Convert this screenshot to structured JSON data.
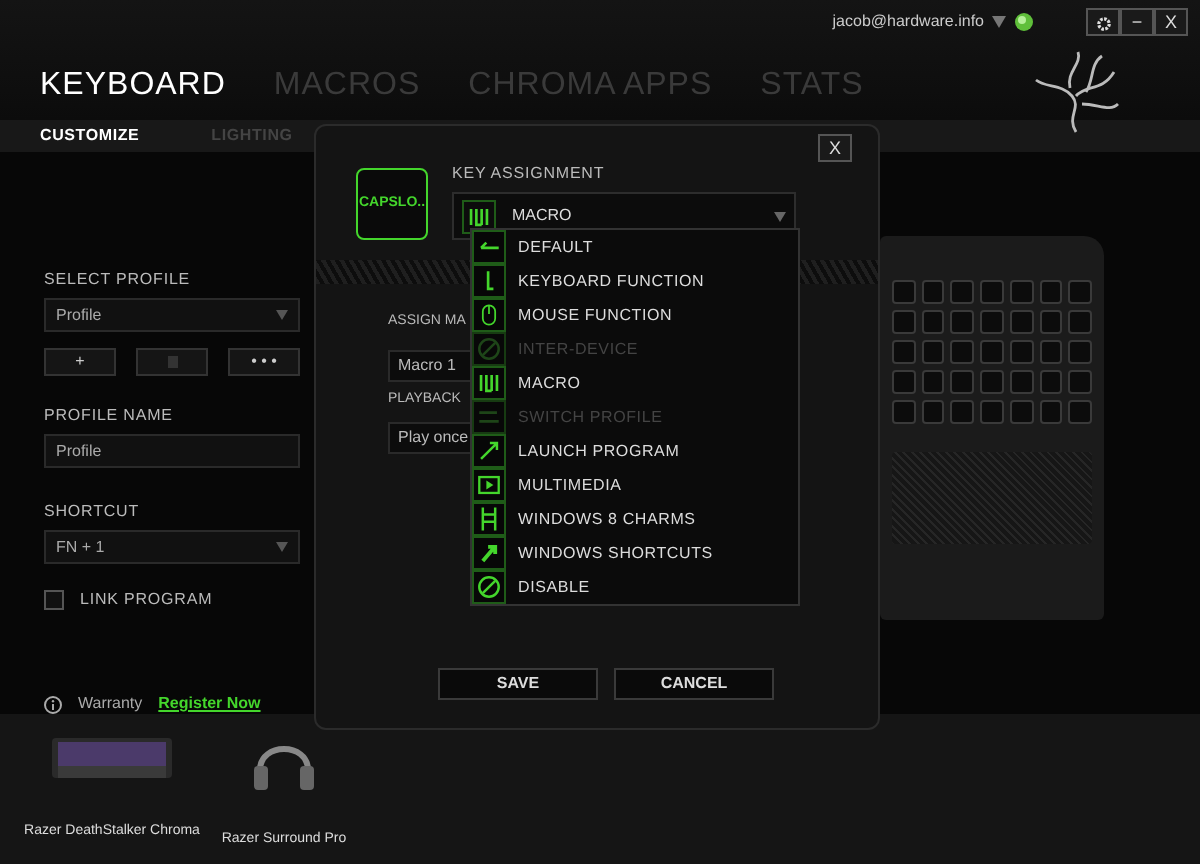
{
  "account": {
    "email": "jacob@hardware.info"
  },
  "window_buttons": [
    "−",
    "X"
  ],
  "tabs": [
    {
      "label": "KEYBOARD",
      "selected": true
    },
    {
      "label": "MACROS",
      "selected": false
    },
    {
      "label": "CHROMA APPS",
      "selected": false
    },
    {
      "label": "STATS",
      "selected": false
    }
  ],
  "subtabs": [
    {
      "label": "CUSTOMIZE",
      "selected": true
    },
    {
      "label": "LIGHTING",
      "selected": false
    }
  ],
  "profile_panel": {
    "select_label": "SELECT PROFILE",
    "profile": "Profile",
    "add_button": "+",
    "more_button": "• • •",
    "name_label": "PROFILE NAME",
    "name_value": "Profile",
    "shortcut_label": "SHORTCUT",
    "shortcut": "FN + 1",
    "link_program": {
      "label": "LINK PROGRAM",
      "checked": false
    }
  },
  "warranty": {
    "label": "Warranty",
    "link": "Register Now"
  },
  "devices": [
    {
      "name": "Razer DeathStalker Chroma"
    },
    {
      "name": "Razer Surround Pro"
    }
  ],
  "dialog": {
    "close": "X",
    "key": "CAPSLO..",
    "title": "KEY ASSIGNMENT",
    "assignment": "MACRO",
    "expanded": true,
    "options": [
      {
        "label": "DEFAULT",
        "disabled": false
      },
      {
        "label": "KEYBOARD FUNCTION",
        "disabled": false
      },
      {
        "label": "MOUSE FUNCTION",
        "disabled": false
      },
      {
        "label": "INTER-DEVICE",
        "disabled": true
      },
      {
        "label": "MACRO",
        "disabled": false
      },
      {
        "label": "SWITCH PROFILE",
        "disabled": true
      },
      {
        "label": "LAUNCH PROGRAM",
        "disabled": false
      },
      {
        "label": "MULTIMEDIA",
        "disabled": false
      },
      {
        "label": "WINDOWS 8 CHARMS",
        "disabled": false
      },
      {
        "label": "WINDOWS SHORTCUTS",
        "disabled": false
      },
      {
        "label": "DISABLE",
        "disabled": false
      }
    ],
    "assign_label": "ASSIGN MA",
    "macro": "Macro 1",
    "playback_label": "PLAYBACK",
    "playback": "Play once",
    "buttons": [
      "SAVE",
      "CANCEL"
    ]
  }
}
